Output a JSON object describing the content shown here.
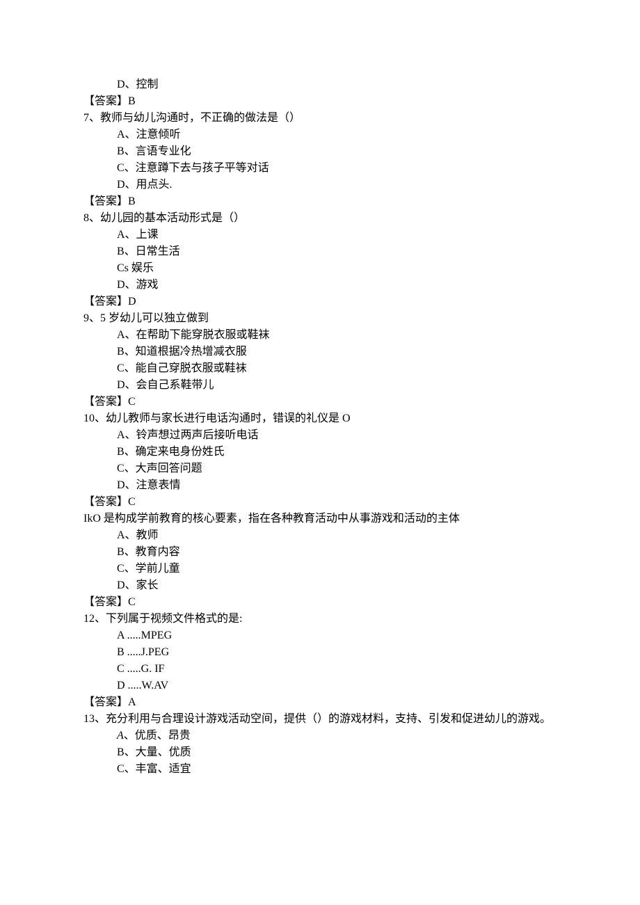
{
  "lines": [
    {
      "cls": "option-line",
      "text": "D、控制"
    },
    {
      "cls": "answer-line",
      "text": "【答案】B"
    },
    {
      "cls": "question-line",
      "text": "7、教师与幼儿沟通时，不正确的做法是（）"
    },
    {
      "cls": "option-line",
      "text": "A、注意倾听"
    },
    {
      "cls": "option-line",
      "text": "B、言语专业化"
    },
    {
      "cls": "option-line",
      "text": "C、注意蹲下去与孩子平等对话"
    },
    {
      "cls": "option-line",
      "text": "D、用点头."
    },
    {
      "cls": "answer-line",
      "text": "【答案】B"
    },
    {
      "cls": "question-line",
      "text": "8、幼儿园的基本活动形式是（）"
    },
    {
      "cls": "option-line",
      "text": "A、上课"
    },
    {
      "cls": "option-line",
      "text": "B、日常生活"
    },
    {
      "cls": "option-line",
      "text": "Cs 娱乐"
    },
    {
      "cls": "option-line",
      "text": "D、游戏"
    },
    {
      "cls": "answer-line",
      "text": "【答案】D"
    },
    {
      "cls": "question-line",
      "text": "9、5 岁幼儿可以独立做到"
    },
    {
      "cls": "option-line",
      "text": "A、在帮助下能穿脱衣服或鞋袜"
    },
    {
      "cls": "option-line",
      "text": "B、知道根据冷热增减衣服"
    },
    {
      "cls": "option-line",
      "text": "C、能自己穿脱衣服或鞋袜"
    },
    {
      "cls": "option-line",
      "text": "D、会自己系鞋带儿"
    },
    {
      "cls": "answer-line",
      "text": "【答案】C"
    },
    {
      "cls": "question-line",
      "text": "10、幼儿教师与家长进行电话沟通时，错误的礼仪是 O"
    },
    {
      "cls": "option-line",
      "text": "A、铃声想过两声后接听电话"
    },
    {
      "cls": "option-line",
      "text": "B、确定来电身份姓氏"
    },
    {
      "cls": "option-line",
      "text": "C、大声回答问题"
    },
    {
      "cls": "option-line",
      "text": "D、注意表情"
    },
    {
      "cls": "answer-line",
      "text": "【答案】C"
    },
    {
      "cls": "question-line",
      "text": "IkO 是构成学前教育的核心要素，指在各种教育活动中从事游戏和活动的主体"
    },
    {
      "cls": "option-line",
      "text": "A、教师"
    },
    {
      "cls": "option-line",
      "text": "B、教育内容"
    },
    {
      "cls": "option-line",
      "text": "C、学前儿童"
    },
    {
      "cls": "option-line",
      "text": "D、家长"
    },
    {
      "cls": "answer-line",
      "text": "【答案】C"
    },
    {
      "cls": "question-line",
      "text": "12、下列属于视频文件格式的是:"
    },
    {
      "cls": "option-line",
      "text": "A .....MPEG"
    },
    {
      "cls": "option-line",
      "text": "B .....J.PEG"
    },
    {
      "cls": "option-line",
      "text": "C .....G. IF"
    },
    {
      "cls": "option-line",
      "text": "D .....W.AV"
    },
    {
      "cls": "answer-line",
      "text": "【答案】A"
    },
    {
      "cls": "question-line",
      "text": "13、充分利用与合理设计游戏活动空间，提供（）的游戏材料，支持、引发和促进幼儿的游戏。"
    },
    {
      "cls": "option-line",
      "prefix_italic": "A",
      "text": "、优质、昂贵"
    },
    {
      "cls": "option-line",
      "text": "B、大量、优质"
    },
    {
      "cls": "option-line",
      "text": "C、丰富、适宜"
    }
  ]
}
